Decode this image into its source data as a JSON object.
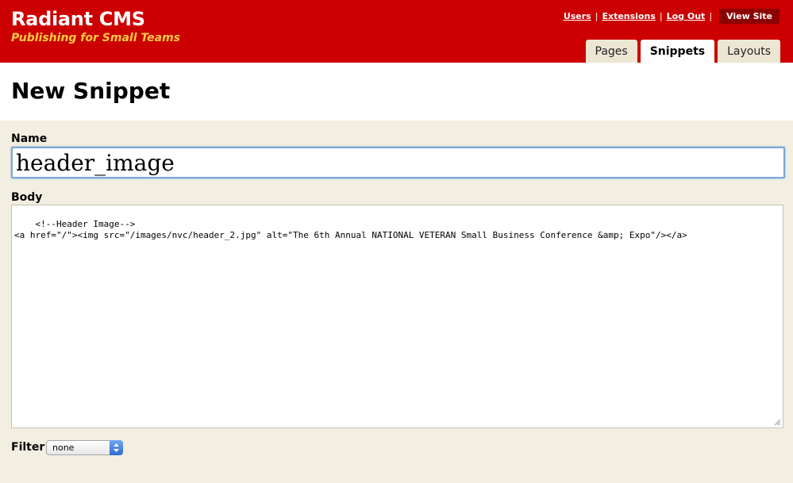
{
  "header": {
    "title": "Radiant CMS",
    "tagline": "Publishing for Small Teams",
    "links": [
      {
        "label": "Users"
      },
      {
        "label": "Extensions"
      },
      {
        "label": "Log Out"
      }
    ],
    "view_site_label": "View Site",
    "tabs": [
      {
        "label": "Pages",
        "active": false
      },
      {
        "label": "Snippets",
        "active": true
      },
      {
        "label": "Layouts",
        "active": false
      }
    ],
    "colors": {
      "brand": "#cc0000",
      "tagline": "#ffcc44",
      "tab": "#ece6d3",
      "form_bg": "#f2efe2"
    }
  },
  "page": {
    "title": "New Snippet"
  },
  "form": {
    "name_label": "Name",
    "name_value": "header_image",
    "body_label": "Body",
    "body_value": "<!--Header Image-->\n<a href=\"/\"><img src=\"/images/nvc/header_2.jpg\" alt=\"The 6th Annual NATIONAL VETERAN Small Business Conference &amp; Expo\"/></a>",
    "filter_label": "Filter",
    "filter_value": "none"
  },
  "icons": {
    "select_arrows": "up-down-arrows-icon",
    "resize": "resize-grip-icon"
  }
}
